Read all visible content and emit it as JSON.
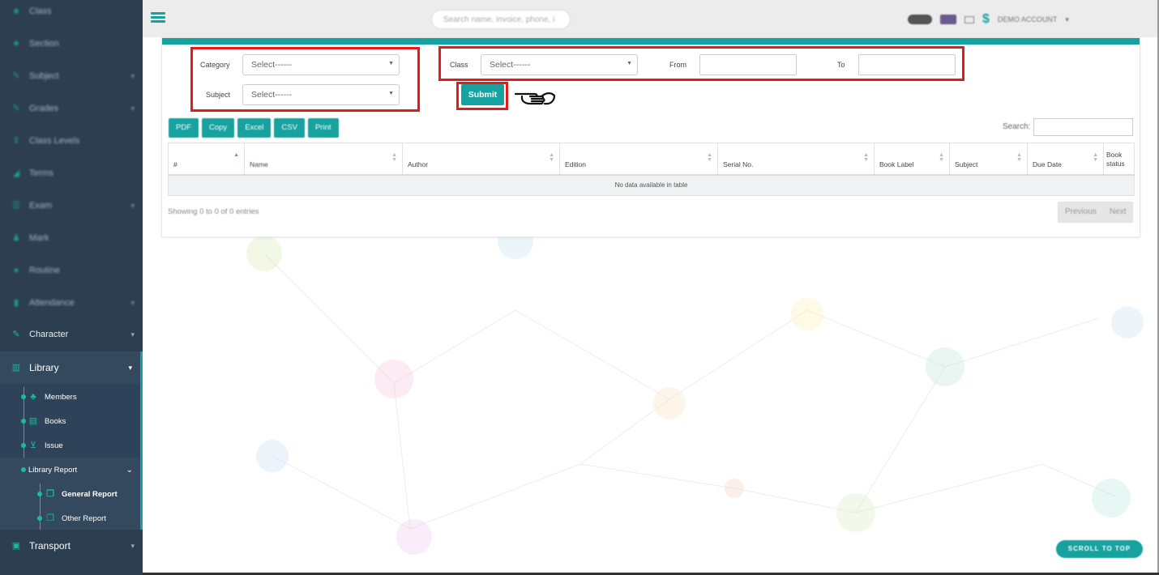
{
  "sidebar": {
    "items": [
      {
        "label": "Class",
        "icon": "sitemap-icon"
      },
      {
        "label": "Section",
        "icon": "star-icon"
      },
      {
        "label": "Subject",
        "icon": "edit-icon"
      },
      {
        "label": "Grades",
        "icon": "edit-icon"
      },
      {
        "label": "Class Levels",
        "icon": "sort-icon"
      },
      {
        "label": "Terms",
        "icon": "signal-icon"
      },
      {
        "label": "Exam",
        "icon": "list-icon"
      },
      {
        "label": "Mark",
        "icon": "user-icon"
      },
      {
        "label": "Routine",
        "icon": "circle-icon"
      },
      {
        "label": "Attendance",
        "icon": "clipboard-icon"
      },
      {
        "label": "Character",
        "icon": "edit-icon"
      }
    ],
    "library": {
      "label": "Library",
      "submenu": [
        {
          "label": "Members",
          "icon": "users-icon"
        },
        {
          "label": "Books",
          "icon": "book-icon"
        },
        {
          "label": "Issue",
          "icon": "cart-icon"
        }
      ],
      "report": {
        "label": "Library Report",
        "submenu": [
          {
            "label": "General Report",
            "icon": "copy-icon"
          },
          {
            "label": "Other Report",
            "icon": "copy-icon"
          }
        ]
      }
    },
    "transport": {
      "label": "Transport",
      "icon": "bus-icon"
    }
  },
  "topbar": {
    "search_placeholder": "Search name, invoice, phone, i",
    "account": "DEMO ACCOUNT"
  },
  "filters": {
    "category_label": "Category",
    "category_value": "Select------",
    "subject_label": "Subject",
    "subject_value": "Select------",
    "class_label": "Class",
    "class_value": "Select------",
    "from_label": "From",
    "to_label": "To",
    "from_value": "",
    "to_value": "",
    "submit_label": "Submit"
  },
  "export_buttons": [
    "PDF",
    "Copy",
    "Excel",
    "CSV",
    "Print"
  ],
  "table": {
    "search_label": "Search:",
    "columns": [
      "#",
      "Name",
      "Author",
      "Edition",
      "Serial No.",
      "Book Label",
      "Subject",
      "Due Date",
      "Book status"
    ],
    "empty_message": "No data available in table",
    "info": "Showing 0 to 0 of 0 entries",
    "prev_label": "Previous",
    "next_label": "Next"
  },
  "scroll_top_label": "SCROLL TO TOP",
  "colors": {
    "sidebar_bg": "#2c3e50",
    "accent": "#17a2a0",
    "highlight": "#e41b1b"
  }
}
